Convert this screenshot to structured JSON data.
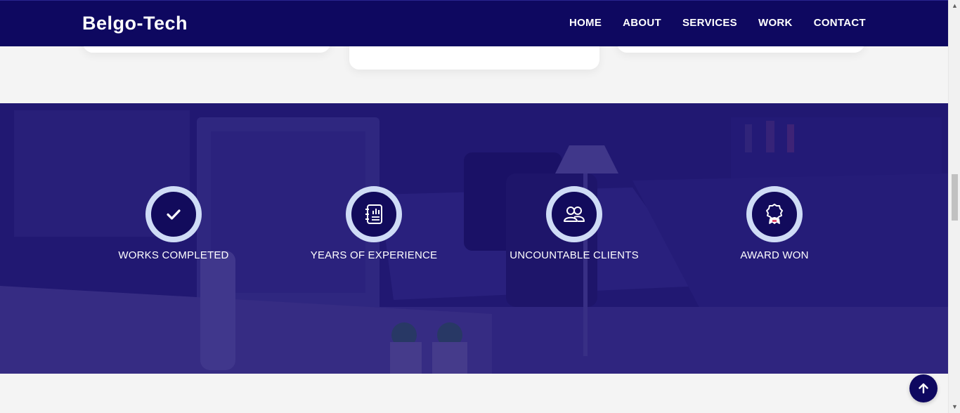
{
  "header": {
    "brand": "Belgo-Tech",
    "nav": [
      "HOME",
      "ABOUT",
      "SERVICES",
      "WORK",
      "CONTACT"
    ]
  },
  "stats": [
    {
      "icon": "check-icon",
      "label": "WORKS COMPLETED"
    },
    {
      "icon": "notebook-chart-icon",
      "label": "YEARS OF EXPERIENCE"
    },
    {
      "icon": "users-icon",
      "label": "UNCOUNTABLE CLIENTS"
    },
    {
      "icon": "award-icon",
      "label": "AWARD WON"
    }
  ],
  "scrollbar": {
    "up": "▲",
    "down": "▼"
  },
  "colors": {
    "header_bg": "#0e0860",
    "banner_overlay": "#1f186e",
    "ring": "#cfdcf6",
    "page_bg": "#f4f4f4"
  }
}
